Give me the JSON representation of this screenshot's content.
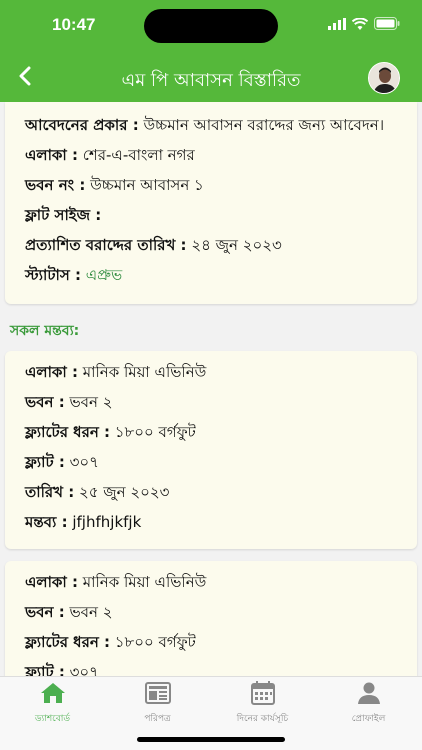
{
  "status": {
    "time": "10:47"
  },
  "header": {
    "title": "এম পি আবাসন বিস্তারিত"
  },
  "application": {
    "type_label": "আবেদনের প্রকার :",
    "type_value": " উচ্চমান আবাসন বরাদ্দের জন্য আবেদন।",
    "area_label": "এলাকা :",
    "area_value": " শের-এ-বাংলা নগর",
    "building_label": "ভবন নং :",
    "building_value": " উচ্চমান আবাসন ১",
    "flat_size_label": "ফ্লাট সাইজ :",
    "flat_size_value": "",
    "expected_date_label": "প্রত্যাশিত বরাদ্দের তারিখ :",
    "expected_date_value": " ২৪ জুন ২০২৩",
    "status_label": "স্ট্যাটাস :",
    "status_value": " এপ্রুভ",
    "status_color": "#2e8b3e"
  },
  "comments_title": "সকল মন্তব্য:",
  "comments": [
    {
      "area_label": "এলাকা :",
      "area_value": " মানিক মিয়া এভিনিউ",
      "building_label": "ভবন :",
      "building_value": " ভবন ২",
      "flat_type_label": "ফ্ল্যাটের ধরন :",
      "flat_type_value": " ১৮০০ বর্গফুট",
      "flat_label": "ফ্ল্যাট :",
      "flat_value": " ৩০৭",
      "date_label": "তারিখ :",
      "date_value": " ২৫ জুন ২০২৩",
      "comment_label": "মন্তব্য :",
      "comment_value": " jfjhfhjkfjk"
    },
    {
      "area_label": "এলাকা :",
      "area_value": " মানিক মিয়া এভিনিউ",
      "building_label": "ভবন :",
      "building_value": " ভবন ২",
      "flat_type_label": "ফ্ল্যাটের ধরন :",
      "flat_type_value": " ১৮০০ বর্গফুট",
      "flat_label": "ফ্ল্যাট :",
      "flat_value": " ৩০৭"
    }
  ],
  "tabs": [
    {
      "label": "ড্যাশবোর্ড",
      "icon": "home-icon",
      "active": true
    },
    {
      "label": "পরিপত্র",
      "icon": "newspaper-icon",
      "active": false
    },
    {
      "label": "দিনের কার্যসূচি",
      "icon": "calendar-icon",
      "active": false
    },
    {
      "label": "প্রোফাইল",
      "icon": "profile-icon",
      "active": false
    }
  ],
  "colors": {
    "primary": "#55b83a",
    "card_bg": "#fcfbed",
    "active_tab": "#4caf50"
  }
}
